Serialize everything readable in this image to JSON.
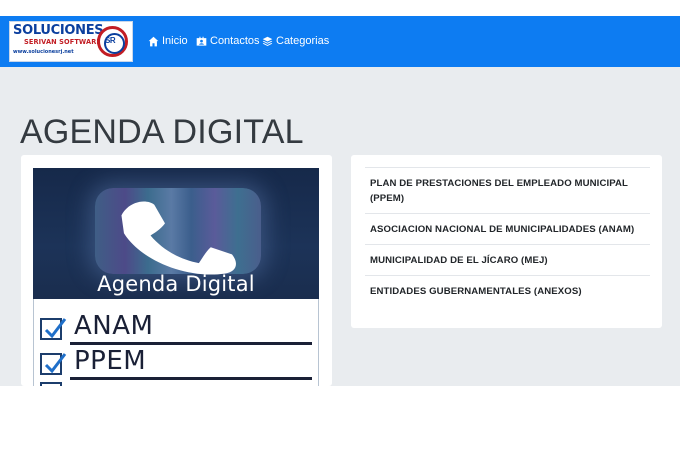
{
  "brand": {
    "title": "SOLUCIONES",
    "subtitle": "SERIVAN SOFTWARE",
    "url": "www.solucionesrj.net",
    "emblem": "SR",
    "primary_color": "#0d7cf2"
  },
  "nav": {
    "items": [
      {
        "label": "Inicio",
        "icon": "home-icon"
      },
      {
        "label": "Contactos",
        "icon": "address-card-icon"
      },
      {
        "label": "Categorias",
        "icon": "layers-icon"
      }
    ]
  },
  "main": {
    "title": "AGENDA DIGITAL",
    "image": {
      "caption": "Agenda Digital",
      "checklist": [
        "ANAM",
        "PPEM"
      ]
    }
  },
  "categories": [
    "PLAN DE PRESTACIONES DEL EMPLEADO MUNICIPAL (PPEM)",
    "ASOCIACION NACIONAL DE MUNICIPALIDADES (ANAM)",
    "MUNICIPALIDAD DE EL JÍCARO (MEJ)",
    "ENTIDADES GUBERNAMENTALES (ANEXOS)"
  ]
}
